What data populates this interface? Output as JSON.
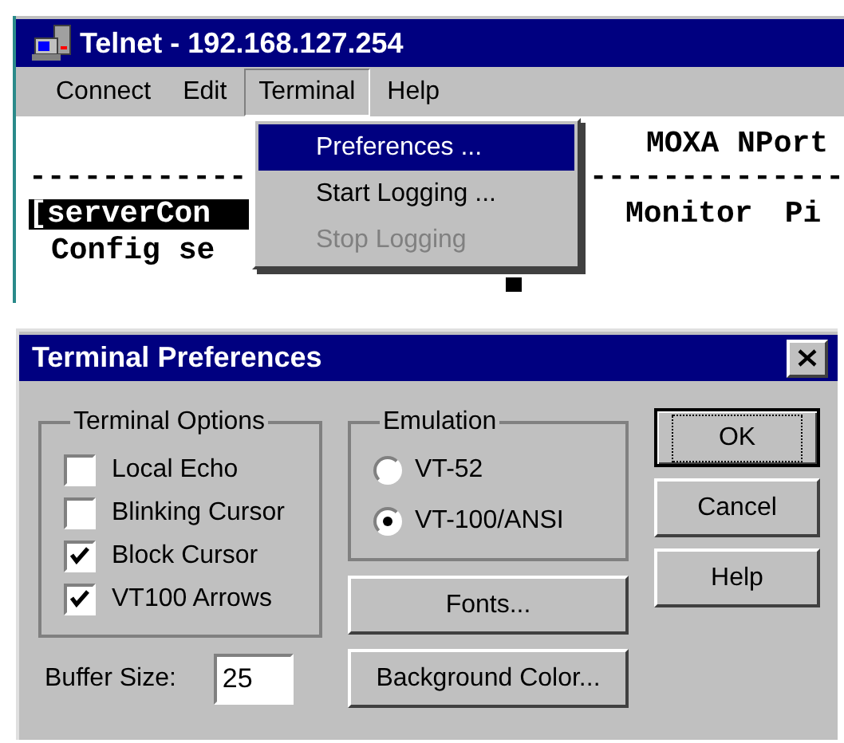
{
  "telnet": {
    "title": "Telnet - 192.168.127.254",
    "menus": [
      {
        "label": "Connect",
        "selected": false
      },
      {
        "label": "Edit",
        "selected": false
      },
      {
        "label": "Terminal",
        "selected": true
      },
      {
        "label": "Help",
        "selected": false
      }
    ],
    "terminal": {
      "header": "MOXA NPort",
      "rule_left": "------------",
      "rule_right": "--------------",
      "menu_path": "[serverCon",
      "monitor": "Monitor",
      "column_3": "Pi",
      "prompt": "Config se"
    },
    "dropdown": [
      {
        "label": "Preferences ...",
        "selected": true,
        "disabled": false
      },
      {
        "label": "Start Logging ...",
        "selected": false,
        "disabled": false
      },
      {
        "label": "Stop Logging",
        "selected": false,
        "disabled": true
      }
    ]
  },
  "dialog": {
    "title": "Terminal Preferences",
    "terminal_options": {
      "title": "Terminal Options",
      "options": [
        {
          "label": "Local Echo",
          "checked": false
        },
        {
          "label": "Blinking Cursor",
          "checked": false
        },
        {
          "label": "Block Cursor",
          "checked": true
        },
        {
          "label": "VT100 Arrows",
          "checked": true
        }
      ]
    },
    "emulation": {
      "title": "Emulation",
      "options": [
        {
          "label": "VT-52",
          "selected": false
        },
        {
          "label": "VT-100/ANSI",
          "selected": true
        }
      ]
    },
    "buttons": [
      {
        "label": "Fonts..."
      },
      {
        "label": "Background Color..."
      }
    ],
    "actions": [
      {
        "label": "OK",
        "default": true
      },
      {
        "label": "Cancel",
        "default": false
      },
      {
        "label": "Help",
        "default": false
      }
    ],
    "buffer_size": {
      "label": "Buffer Size:",
      "value": "25"
    }
  }
}
